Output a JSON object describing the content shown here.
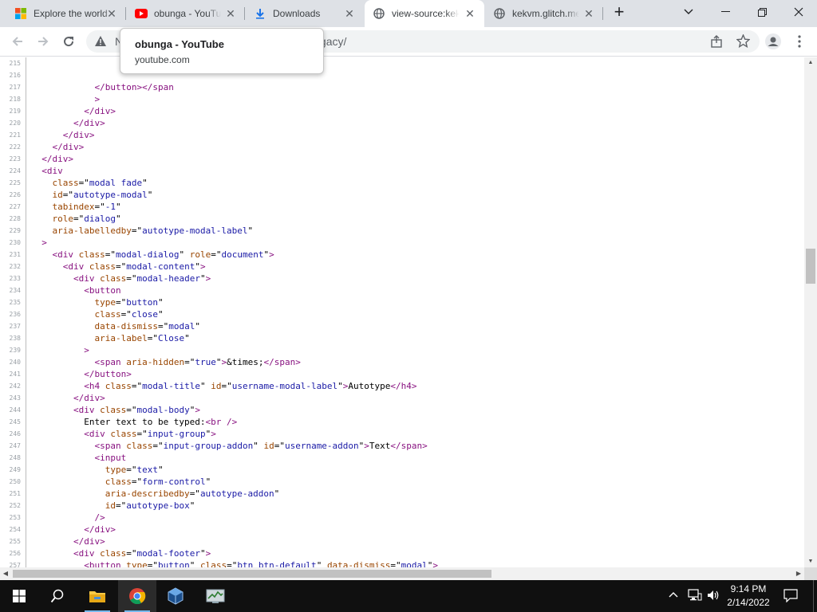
{
  "tabs": [
    {
      "title": "Explore the world",
      "icon": "windows-logo-icon",
      "active": false
    },
    {
      "title": "obunga - YouTube",
      "icon": "youtube-icon",
      "active": false
    },
    {
      "title": "Downloads",
      "icon": "download-icon",
      "active": false
    },
    {
      "title": "view-source:kekvm.glitch.me/legacy/",
      "icon": "globe-icon",
      "active": true
    },
    {
      "title": "kekvm.glitch.me",
      "icon": "globe-icon",
      "active": false
    }
  ],
  "toolbar": {
    "security_label": "N",
    "url_host": "",
    "url_path": "/legacy/"
  },
  "hovercard": {
    "title": "obunga - YouTube",
    "domain": "youtube.com"
  },
  "source_lines": [
    {
      "n": "215",
      "html": ""
    },
    {
      "n": "216",
      "html": ""
    },
    {
      "n": "217",
      "html": "            <span class=\"t\">&lt;/button&gt;&lt;/span</span>"
    },
    {
      "n": "218",
      "html": "            <span class=\"t\">&gt;</span>"
    },
    {
      "n": "219",
      "html": "          <span class=\"t\">&lt;/div&gt;</span>"
    },
    {
      "n": "220",
      "html": "        <span class=\"t\">&lt;/div&gt;</span>"
    },
    {
      "n": "221",
      "html": "      <span class=\"t\">&lt;/div&gt;</span>"
    },
    {
      "n": "222",
      "html": "    <span class=\"t\">&lt;/div&gt;</span>"
    },
    {
      "n": "223",
      "html": "  <span class=\"t\">&lt;/div&gt;</span>"
    },
    {
      "n": "224",
      "html": "  <span class=\"t\">&lt;div</span>"
    },
    {
      "n": "225",
      "html": "    <span class=\"a\">class</span>=\"<span class=\"v\">modal fade</span>\""
    },
    {
      "n": "226",
      "html": "    <span class=\"a\">id</span>=\"<span class=\"v\">autotype-modal</span>\""
    },
    {
      "n": "227",
      "html": "    <span class=\"a\">tabindex</span>=\"<span class=\"v\">-1</span>\""
    },
    {
      "n": "228",
      "html": "    <span class=\"a\">role</span>=\"<span class=\"v\">dialog</span>\""
    },
    {
      "n": "229",
      "html": "    <span class=\"a\">aria-labelledby</span>=\"<span class=\"v\">autotype-modal-label</span>\""
    },
    {
      "n": "230",
      "html": "  <span class=\"t\">&gt;</span>"
    },
    {
      "n": "231",
      "html": "    <span class=\"t\">&lt;div </span><span class=\"a\">class</span>=\"<span class=\"v\">modal-dialog</span>\" <span class=\"a\">role</span>=\"<span class=\"v\">document</span>\"<span class=\"t\">&gt;</span>"
    },
    {
      "n": "232",
      "html": "      <span class=\"t\">&lt;div </span><span class=\"a\">class</span>=\"<span class=\"v\">modal-content</span>\"<span class=\"t\">&gt;</span>"
    },
    {
      "n": "233",
      "html": "        <span class=\"t\">&lt;div </span><span class=\"a\">class</span>=\"<span class=\"v\">modal-header</span>\"<span class=\"t\">&gt;</span>"
    },
    {
      "n": "234",
      "html": "          <span class=\"t\">&lt;button</span>"
    },
    {
      "n": "235",
      "html": "            <span class=\"a\">type</span>=\"<span class=\"v\">button</span>\""
    },
    {
      "n": "236",
      "html": "            <span class=\"a\">class</span>=\"<span class=\"v\">close</span>\""
    },
    {
      "n": "237",
      "html": "            <span class=\"a\">data-dismiss</span>=\"<span class=\"v\">modal</span>\""
    },
    {
      "n": "238",
      "html": "            <span class=\"a\">aria-label</span>=\"<span class=\"v\">Close</span>\""
    },
    {
      "n": "239",
      "html": "          <span class=\"t\">&gt;</span>"
    },
    {
      "n": "240",
      "html": "            <span class=\"t\">&lt;span </span><span class=\"a\">aria-hidden</span>=\"<span class=\"v\">true</span>\"<span class=\"t\">&gt;</span>&amp;times;<span class=\"t\">&lt;/span&gt;</span>"
    },
    {
      "n": "241",
      "html": "          <span class=\"t\">&lt;/button&gt;</span>"
    },
    {
      "n": "242",
      "html": "          <span class=\"t\">&lt;h4 </span><span class=\"a\">class</span>=\"<span class=\"v\">modal-title</span>\" <span class=\"a\">id</span>=\"<span class=\"v\">username-modal-label</span>\"<span class=\"t\">&gt;</span>Autotype<span class=\"t\">&lt;/h4&gt;</span>"
    },
    {
      "n": "243",
      "html": "        <span class=\"t\">&lt;/div&gt;</span>"
    },
    {
      "n": "244",
      "html": "        <span class=\"t\">&lt;div </span><span class=\"a\">class</span>=\"<span class=\"v\">modal-body</span>\"<span class=\"t\">&gt;</span>"
    },
    {
      "n": "245",
      "html": "          Enter text to be typed:<span class=\"t\">&lt;br /&gt;</span>"
    },
    {
      "n": "246",
      "html": "          <span class=\"t\">&lt;div </span><span class=\"a\">class</span>=\"<span class=\"v\">input-group</span>\"<span class=\"t\">&gt;</span>"
    },
    {
      "n": "247",
      "html": "            <span class=\"t\">&lt;span </span><span class=\"a\">class</span>=\"<span class=\"v\">input-group-addon</span>\" <span class=\"a\">id</span>=\"<span class=\"v\">username-addon</span>\"<span class=\"t\">&gt;</span>Text<span class=\"t\">&lt;/span&gt;</span>"
    },
    {
      "n": "248",
      "html": "            <span class=\"t\">&lt;input</span>"
    },
    {
      "n": "249",
      "html": "              <span class=\"a\">type</span>=\"<span class=\"v\">text</span>\""
    },
    {
      "n": "250",
      "html": "              <span class=\"a\">class</span>=\"<span class=\"v\">form-control</span>\""
    },
    {
      "n": "251",
      "html": "              <span class=\"a\">aria-describedby</span>=\"<span class=\"v\">autotype-addon</span>\""
    },
    {
      "n": "252",
      "html": "              <span class=\"a\">id</span>=\"<span class=\"v\">autotype-box</span>\""
    },
    {
      "n": "253",
      "html": "            <span class=\"t\">/&gt;</span>"
    },
    {
      "n": "254",
      "html": "          <span class=\"t\">&lt;/div&gt;</span>"
    },
    {
      "n": "255",
      "html": "        <span class=\"t\">&lt;/div&gt;</span>"
    },
    {
      "n": "256",
      "html": "        <span class=\"t\">&lt;div </span><span class=\"a\">class</span>=\"<span class=\"v\">modal-footer</span>\"<span class=\"t\">&gt;</span>"
    },
    {
      "n": "257",
      "html": "          <span class=\"t\">&lt;button </span><span class=\"a\">type</span>=\"<span class=\"v\">button</span>\" <span class=\"a\">class</span>=\"<span class=\"v\">btn btn-default</span>\" <span class=\"a\">data-dismiss</span>=\"<span class=\"v\">modal</span>\"<span class=\"t\">&gt;</span>"
    }
  ],
  "scroll": {
    "vertical_position": 0.37,
    "horizontal_fraction": 0.6
  },
  "taskbar": {
    "apps": [
      "start-icon",
      "search-icon",
      "file-explorer-icon",
      "chrome-icon",
      "virtualbox-icon",
      "task-manager-icon"
    ],
    "active_app": "chrome-icon"
  },
  "clock": {
    "time": "9:14 PM",
    "date": "2/14/2022"
  },
  "colors": {
    "tag": "#881280",
    "attr": "#994500",
    "value": "#1a1aa6",
    "youtube": "#ff0000",
    "chrome_accent": "#1a73e8"
  }
}
